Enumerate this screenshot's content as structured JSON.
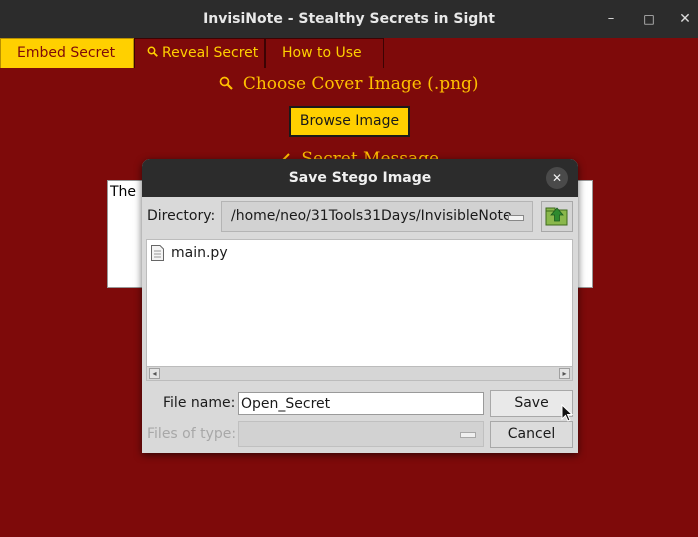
{
  "window": {
    "title": "InvisiNote - Stealthy Secrets in Sight",
    "minimize_glyph": "–",
    "maximize_glyph": "□",
    "close_glyph": "✕"
  },
  "tabs": [
    {
      "label": "Embed Secret",
      "active": true
    },
    {
      "label": "Reveal Secret",
      "icon": "magnifier-icon",
      "active": false
    },
    {
      "label": "How to Use",
      "active": false
    }
  ],
  "main": {
    "cover_heading": "Choose Cover Image (.png)",
    "browse_label": "Browse Image",
    "secret_heading": "Secret Message",
    "secret_text": "The"
  },
  "dialog": {
    "title": "Save Stego Image",
    "close_glyph": "✕",
    "directory_label": "Directory:",
    "directory_value": "/home/neo/31Tools31Days/InvisibleNote",
    "files": [
      "main.py"
    ],
    "filename_label": "File name:",
    "filename_value": "Open_Secret",
    "filetype_label": "Files of type:",
    "filetype_value": "",
    "save_label": "Save",
    "cancel_label": "Cancel"
  },
  "colors": {
    "background": "#7e0a0a",
    "accent": "#ffd000",
    "heading": "#ffc000",
    "titlebar": "#2c2c2c"
  }
}
